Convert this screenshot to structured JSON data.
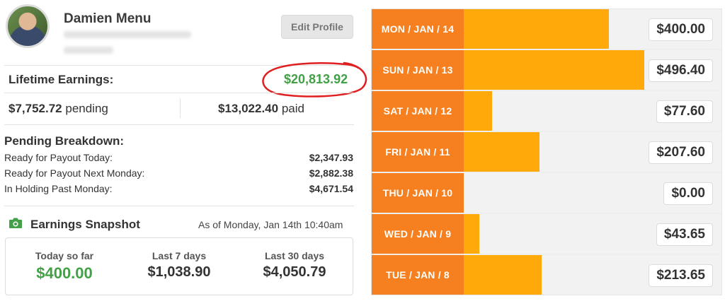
{
  "profile": {
    "name": "Damien Menu",
    "edit_button": "Edit Profile"
  },
  "lifetime": {
    "label": "Lifetime Earnings:",
    "value": "$20,813.92",
    "pending_amount": "$7,752.72",
    "pending_suffix": " pending",
    "paid_amount": "$13,022.40",
    "paid_suffix": " paid"
  },
  "pending_breakdown": {
    "title": "Pending Breakdown:",
    "rows": [
      {
        "label": "Ready for Payout Today:",
        "value": "$2,347.93"
      },
      {
        "label": "Ready for Payout Next Monday:",
        "value": "$2,882.38"
      },
      {
        "label": "In Holding Past Monday:",
        "value": "$4,671.54"
      }
    ]
  },
  "snapshot": {
    "title": "Earnings Snapshot",
    "as_of": "As of Monday, Jan 14th 10:40am",
    "columns": [
      {
        "label": "Today so far",
        "value": "$400.00"
      },
      {
        "label": "Last 7 days",
        "value": "$1,038.90"
      },
      {
        "label": "Last 30 days",
        "value": "$4,050.79"
      }
    ]
  },
  "daily": {
    "max": 496.4,
    "days": [
      {
        "label": "MON / JAN / 14",
        "amount": "$400.00",
        "value": 400.0
      },
      {
        "label": "SUN / JAN / 13",
        "amount": "$496.40",
        "value": 496.4
      },
      {
        "label": "SAT / JAN / 12",
        "amount": "$77.60",
        "value": 77.6
      },
      {
        "label": "FRI / JAN / 11",
        "amount": "$207.60",
        "value": 207.6
      },
      {
        "label": "THU / JAN / 10",
        "amount": "$0.00",
        "value": 0.0
      },
      {
        "label": "WED / JAN / 9",
        "amount": "$43.65",
        "value": 43.65
      },
      {
        "label": "TUE / JAN / 8",
        "amount": "$213.65",
        "value": 213.65
      }
    ]
  },
  "colors": {
    "accent_green": "#43a047",
    "day_label_orange": "#f6801f",
    "bar_orange": "#ffa90a",
    "annotation_red": "#e02020"
  }
}
